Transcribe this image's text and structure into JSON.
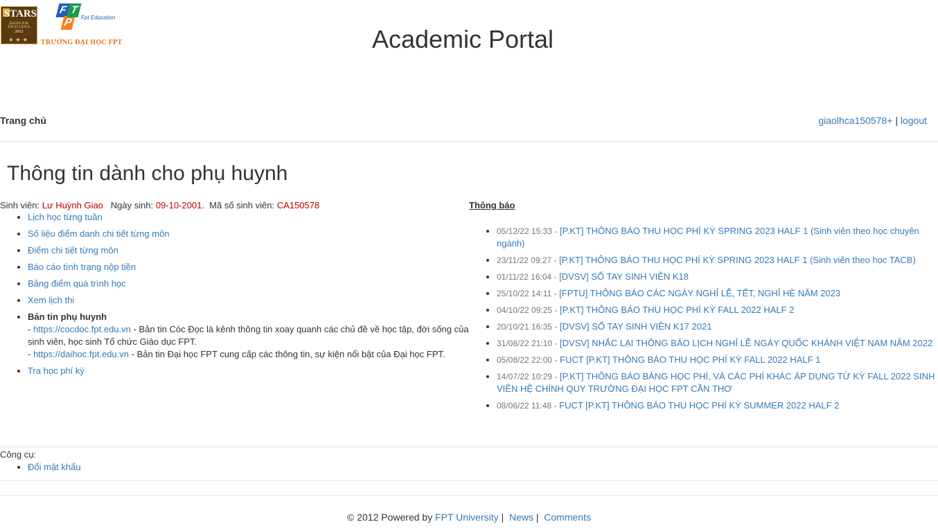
{
  "header": {
    "stars_logo": {
      "title": "STARS",
      "rated": "RATED FOR EXCELLENCE",
      "year": "2012",
      "stars": "★★★"
    },
    "fpt_logo": {
      "letters": [
        "F",
        "P",
        "T"
      ],
      "education": "Fpt Education",
      "university": "TRƯỜNG ĐẠI HỌC FPT"
    },
    "app_title": "Academic Portal"
  },
  "nav": {
    "home": "Trang chủ",
    "username": "giaolhca150578+",
    "separator": "|",
    "logout": "logout"
  },
  "page_title": "Thông tin dành cho phụ huynh",
  "student": {
    "label_name": "Sinh viên:",
    "name": "Lư Huỳnh Giao",
    "label_dob": "Ngày sinh:",
    "dob": "09-10-2001",
    "label_id": "Mã số sinh viên:",
    "id": "CA150578"
  },
  "menu": [
    "Lịch học từng tuần",
    "Số liệu điểm danh chi tiết từng môn",
    "Điểm chi tiết từng môn",
    "Báo cáo tình trạng nộp tiền",
    "Bảng điểm quá trình học",
    "Xem lịch thi"
  ],
  "newsletter": {
    "title": "Bản tin phụ huynh",
    "items": [
      {
        "url": "https://cocdoc.fpt.edu.vn",
        "desc": "- Bản tin Cóc Đọc là kênh thông tin xoay quanh các chủ đề về học tập, đời sống của sinh viên, học sinh Tổ chức Giáo dục FPT."
      },
      {
        "url": "https://daihoc.fpt.edu.vn",
        "desc": "- Bản tin Đại học FPT cung cấp các thông tin, sự kiện nổi bật của Đại học FPT."
      }
    ]
  },
  "menu_last": "Tra học phí kỳ",
  "notices": {
    "title": "Thông báo",
    "items": [
      {
        "date": "05/12/22 15:33 -",
        "title": "[P.KT] THÔNG BÁO THU HỌC PHÍ KỲ SPRING 2023 HALF 1 (Sinh viên theo học chuyên ngành)"
      },
      {
        "date": "23/11/22 09:27 -",
        "title": "[P.KT] THÔNG BÁO THU HỌC PHÍ KỲ SPRING 2023 HALF 1 (Sinh viên theo học TACB)"
      },
      {
        "date": "01/11/22 16:04 -",
        "title": "[DVSV] SỔ TAY SINH VIÊN K18"
      },
      {
        "date": "25/10/22 14:11 -",
        "title": "[FPTU] THÔNG BÁO CÁC NGÀY NGHỈ LỄ, TẾT, NGHỈ HÈ NĂM 2023"
      },
      {
        "date": "04/10/22 09:25 -",
        "title": "[P.KT] THÔNG BÁO THU HỌC PHÍ KỲ FALL 2022 HALF 2"
      },
      {
        "date": "20/10/21 16:35 -",
        "title": "[DVSV] SỔ TAY SINH VIÊN K17 2021"
      },
      {
        "date": "31/08/22 21:10 -",
        "title": "[DVSV] NHẮC LẠI THÔNG BÁO LỊCH NGHỈ LỄ NGÀY QUỐC KHÁNH VIỆT NAM NĂM 2022"
      },
      {
        "date": "05/08/22 22:00 -",
        "title": "FUCT [P.KT] THÔNG BÁO THU HỌC PHÍ KỲ FALL 2022 HALF 1"
      },
      {
        "date": "14/07/22 10:29 -",
        "title": "[P.KT] THÔNG BÁO BẢNG HỌC PHÍ, VÀ CÁC PHÍ KHÁC ÁP DỤNG TỪ KỲ FALL 2022 SINH VIÊN HỆ CHÍNH QUY TRƯỜNG ĐẠI HỌC FPT CẦN THƠ"
      },
      {
        "date": "08/06/22 11:48 -",
        "title": "FUCT [P.KT] THÔNG BÁO THU HỌC PHÍ KỲ SUMMER 2022 HALF 2"
      }
    ]
  },
  "tools": {
    "label": "Công cụ:",
    "items": [
      "Đổi mật khẩu"
    ]
  },
  "footer": {
    "copyright": "© 2012 Powered by",
    "fpt_university": "FPT University",
    "sep": "|",
    "news": "News",
    "comments": "Comments"
  },
  "colors": {
    "link": "#337ab7",
    "highlight": "#c00000",
    "text": "#333333",
    "muted": "#777777"
  }
}
